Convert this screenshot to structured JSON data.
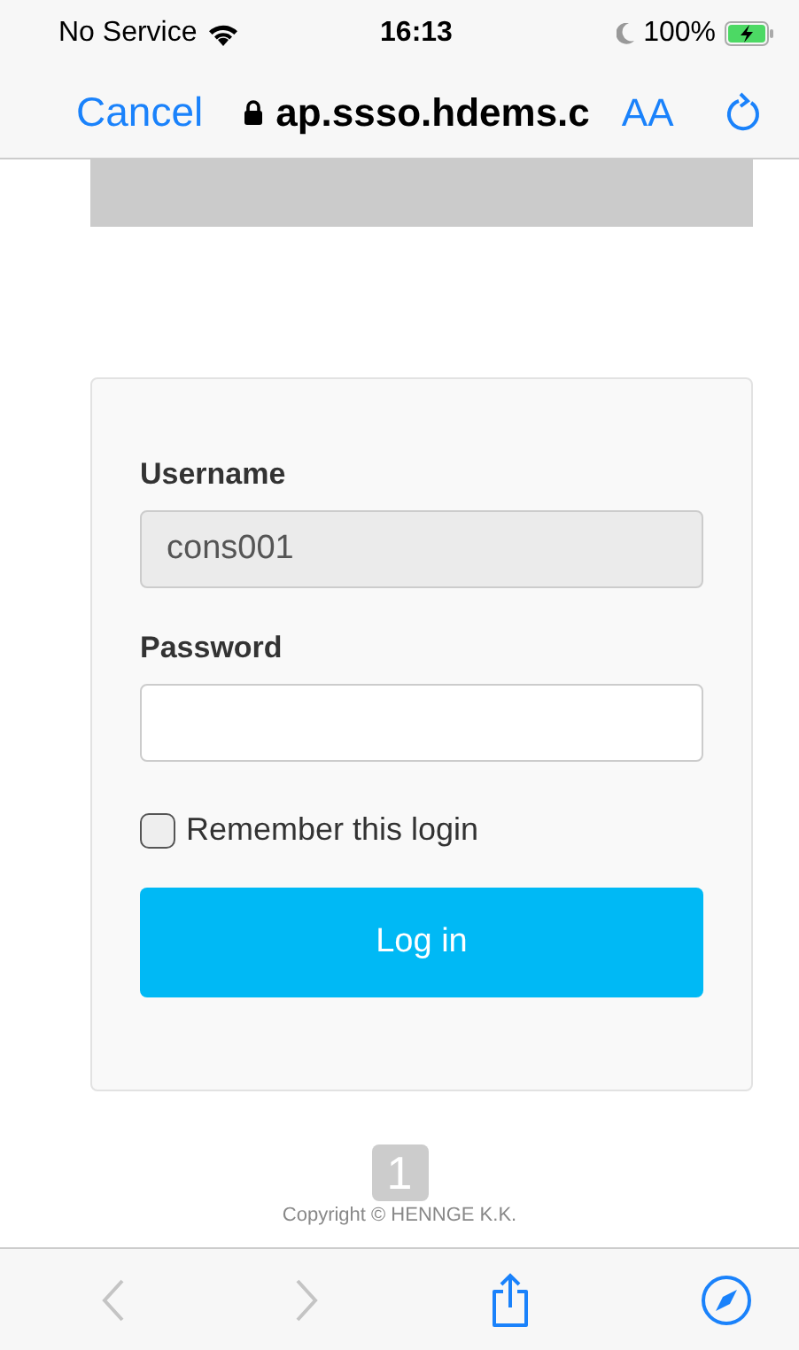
{
  "status_bar": {
    "carrier": "No Service",
    "time": "16:13",
    "battery": "100%",
    "charging": true
  },
  "browser_bar": {
    "cancel": "Cancel",
    "address": "ap.ssso.hdems.c",
    "text_size": "AA"
  },
  "form": {
    "username_label": "Username",
    "username_value": "cons001",
    "username_disabled": true,
    "password_label": "Password",
    "remember_label": "Remember this login",
    "remember_checked": false,
    "login_button": "Log in"
  },
  "footer": {
    "logo": "1",
    "copyright": "Copyright © HENNGE K.K."
  },
  "toolbar": {
    "back_disabled": true,
    "forward_disabled": true
  }
}
